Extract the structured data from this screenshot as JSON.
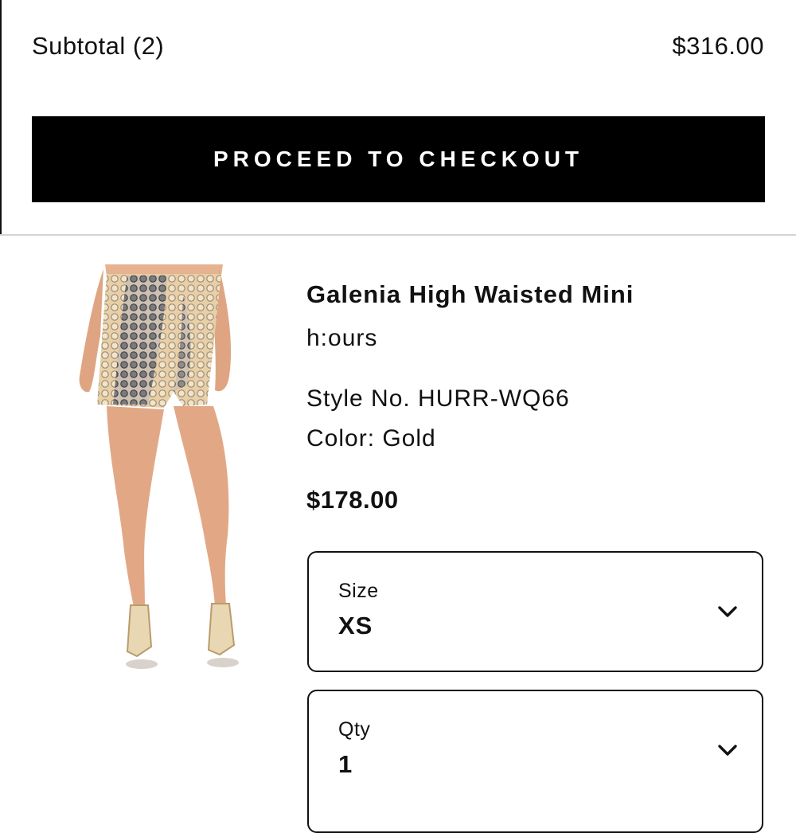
{
  "cart": {
    "subtotal_label": "Subtotal (2)",
    "subtotal_amount": "$316.00",
    "checkout_label": "PROCEED TO CHECKOUT"
  },
  "item": {
    "name": "Galenia High Waisted Mini",
    "brand": "h:ours",
    "style_no": "Style No. HURR-WQ66",
    "color": "Color: Gold",
    "price": "$178.00",
    "image_alt": "gold-sequin-mini-skirt-product-photo",
    "size": {
      "label": "Size",
      "value": "XS",
      "icon": "chevron-down-icon"
    },
    "qty": {
      "label": "Qty",
      "value": "1",
      "icon": "chevron-down-icon"
    }
  },
  "colors": {
    "button_bg": "#000000",
    "button_text": "#ffffff",
    "divider": "#d4d4d4",
    "text": "#111111"
  }
}
